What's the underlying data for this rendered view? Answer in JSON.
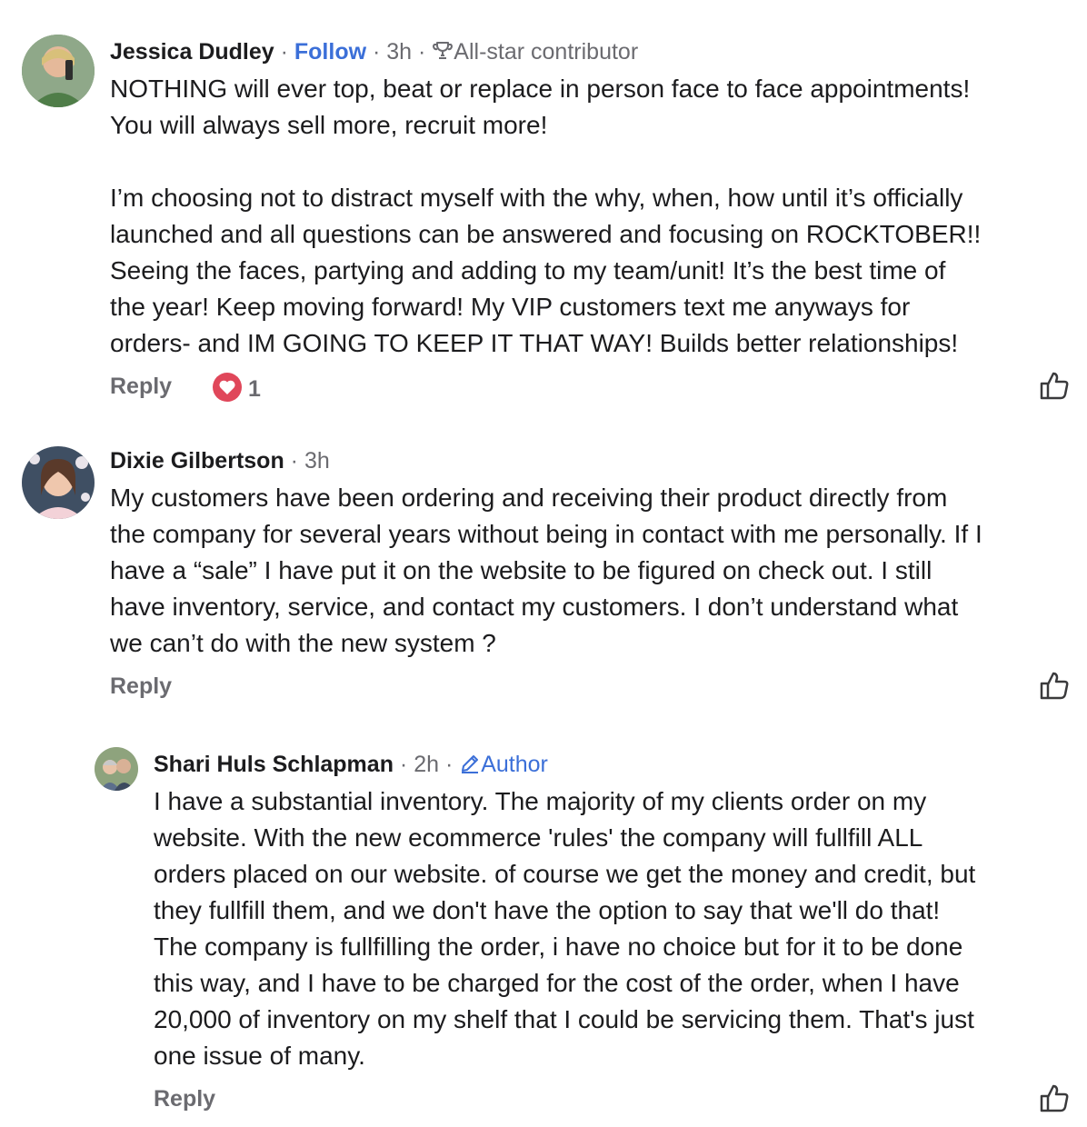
{
  "comments": [
    {
      "name": "Jessica Dudley",
      "follow": "Follow",
      "time": "3h",
      "badge": "All-star contributor",
      "body": "NOTHING will ever top, beat or replace in person face to face appointments!\nYou will always sell more, recruit more!\n\nI’m choosing not to distract myself with the why, when, how until it’s officially\nlaunched and all questions can be answered and focusing on ROCKTOBER!!\nSeeing the faces, partying and adding to my team/unit! It’s the best time of\nthe year! Keep moving forward! My VIP customers text me anyways for\norders- and IM GOING TO KEEP IT THAT WAY! Builds better relationships!",
      "reply": "Reply",
      "reaction_count": "1"
    },
    {
      "name": "Dixie Gilbertson",
      "time": "3h",
      "body": "My customers have been ordering and receiving their product directly from\nthe company for several years without being in contact with me personally. If I\nhave a “sale” I have put it on the website to be figured on check out. I still\nhave inventory, service, and contact my customers.  I don’t understand what\nwe can’t do with the new system ?",
      "reply": "Reply"
    },
    {
      "name": "Shari Huls Schlapman",
      "time": "2h",
      "badge": "Author",
      "body": "I have a substantial inventory.  The majority of my clients order on my\nwebsite.  With the new ecommerce 'rules' the company will fullfill ALL\norders placed on our website.  of course we get the money and credit, but\nthey fullfill them, and we don't have the option to say that we'll do that!\nThe company is fullfilling the order, i have no choice but for it to be done\nthis way, and I have to be charged for the cost of the order, when I have\n20,000 of inventory on my shelf that I could be servicing them.  That's just\none issue of many.",
      "reply": "Reply"
    }
  ],
  "colors": {
    "link": "#3b6fd8",
    "meta": "#6b6b70",
    "heart": "#e0475a"
  },
  "icons": {
    "badge": "trophy-icon",
    "author": "pencil-icon",
    "like": "thumbs-up-icon",
    "reaction": "heart-icon"
  }
}
